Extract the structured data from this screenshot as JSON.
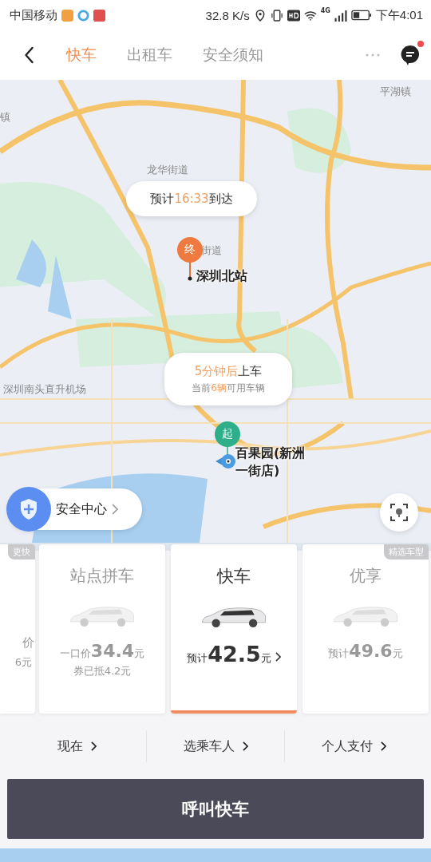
{
  "status_bar": {
    "carrier": "中国移动",
    "speed": "32.8 K/s",
    "network": "4G",
    "time": "下午4:01"
  },
  "nav": {
    "tabs": [
      {
        "label": "快车",
        "selected": true
      },
      {
        "label": "出租车",
        "selected": false
      },
      {
        "label": "安全须知",
        "selected": false
      }
    ],
    "has_unread": true
  },
  "map": {
    "labels": [
      "平湖镇",
      "镇",
      "龙华街道",
      "街道",
      "深圳南头直升机场"
    ],
    "eta": {
      "prefix": "预计",
      "time": "16:33",
      "suffix": "到达"
    },
    "destination": {
      "pin": "终",
      "name": "深圳北站"
    },
    "pickup": {
      "wait": "5分钟后",
      "action": "上车",
      "count_prefix": "当前",
      "count": "6辆",
      "count_suffix": "可用车辆"
    },
    "origin": {
      "pin": "起",
      "name": "百果园(新洲一街店)"
    },
    "safety_button": "安全中心"
  },
  "cards": [
    {
      "kind": "partial",
      "badge": "更快",
      "price_prefix": "价",
      "note": "6元",
      "selected": false
    },
    {
      "kind": "full",
      "title": "站点拼车",
      "price_prefix": "一口价",
      "price": "34.4",
      "unit": "元",
      "note": "券已抵4.2元",
      "selected": false
    },
    {
      "kind": "full",
      "title": "快车",
      "price_prefix": "预计",
      "price": "42.5",
      "unit": "元",
      "selected": true
    },
    {
      "kind": "full",
      "badge": "精选车型",
      "title": "优享",
      "price_prefix": "预计",
      "price": "49.6",
      "unit": "元",
      "selected": false
    }
  ],
  "options": [
    "现在",
    "选乘车人",
    "个人支付"
  ],
  "call_button": "呼叫快车"
}
